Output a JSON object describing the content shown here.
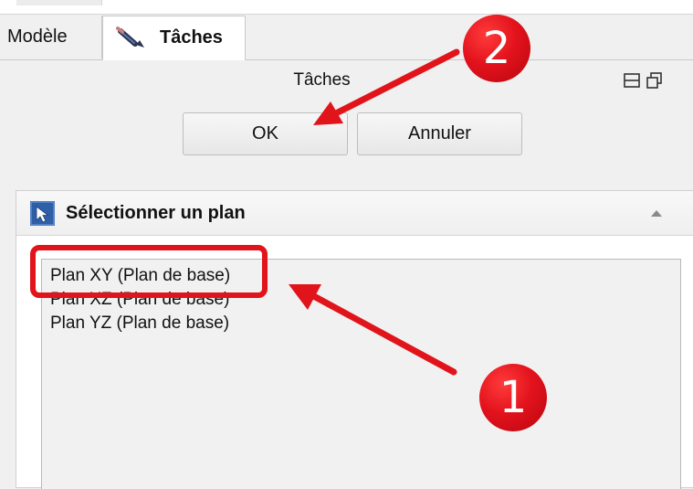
{
  "tabs": {
    "model": "Modèle",
    "tasks": "Tâches"
  },
  "panel": {
    "title": "Tâches",
    "ok_label": "OK",
    "cancel_label": "Annuler"
  },
  "section": {
    "title": "Sélectionner un plan",
    "collapse_icon": "triangle-up-icon"
  },
  "planes": [
    "Plan XY (Plan de base)",
    "Plan XZ (Plan de base)",
    "Plan YZ (Plan de base)"
  ],
  "annotations": {
    "step1": "1",
    "step2": "2",
    "color": "#e0141a"
  }
}
